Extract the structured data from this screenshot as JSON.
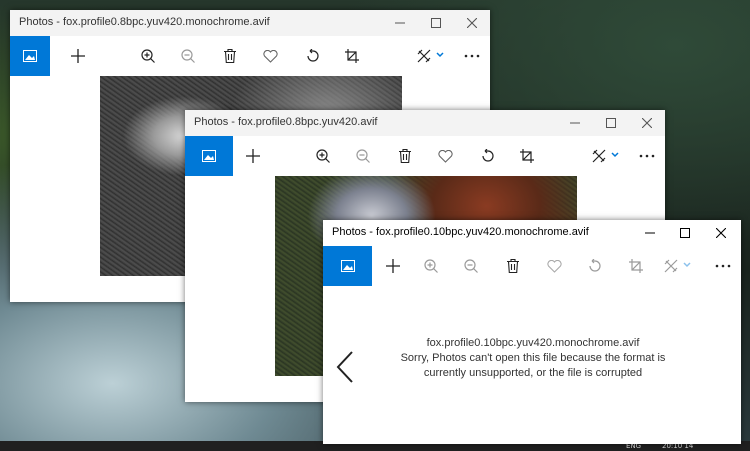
{
  "windows": [
    {
      "title": "Photos - fox.profile0.8bpc.yuv420.monochrome.avif"
    },
    {
      "title": "Photos - fox.profile0.8bpc.yuv420.avif"
    },
    {
      "title": "Photos - fox.profile0.10bpc.yuv420.monochrome.avif",
      "error": {
        "filename": "fox.profile0.10bpc.yuv420.monochrome.avif",
        "line1": "Sorry, Photos can't open this file because the format is",
        "line2": "currently unsupported, or the file is corrupted"
      }
    }
  ],
  "toolbar_icons": [
    "collection-icon",
    "add-icon",
    "zoom-in-icon",
    "zoom-out-icon",
    "delete-icon",
    "favorite-icon",
    "rotate-icon",
    "crop-icon",
    "edit-icon",
    "more-icon"
  ],
  "colors": {
    "accent": "#0078d7",
    "titlebar_active": "#ffffff",
    "titlebar_inactive": "#f3f3f3"
  },
  "taskbar": {
    "time": "20:10 14",
    "lang": "ENG"
  }
}
